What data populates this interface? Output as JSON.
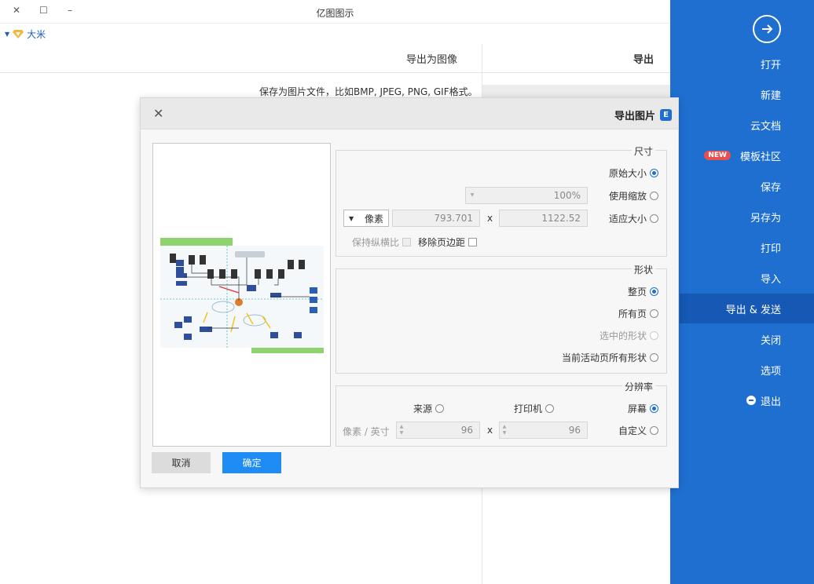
{
  "window": {
    "title": "亿图图示",
    "user": "大米"
  },
  "sidebar": {
    "items": [
      {
        "label": "打开"
      },
      {
        "label": "新建"
      },
      {
        "label": "云文档"
      },
      {
        "label": "模板社区",
        "badge": "NEW"
      },
      {
        "label": "保存"
      },
      {
        "label": "另存为"
      },
      {
        "label": "打印"
      },
      {
        "label": "导入"
      },
      {
        "label": "导出 & 发送"
      },
      {
        "label": "关闭"
      },
      {
        "label": "选项"
      },
      {
        "label": "退出"
      }
    ]
  },
  "panel": {
    "export_title": "导出",
    "export_image_title": "导出为图像",
    "description": "保存为图片文件，比如BMP, JPEG, PNG, GIF格式。"
  },
  "dialog": {
    "title": "导出图片",
    "size": {
      "legend": "尺寸",
      "original": "原始大小",
      "use_scale": "使用缩放",
      "scale_value": "100%",
      "fit_size": "适应大小",
      "width": "1122.52",
      "height": "793.701",
      "times": "x",
      "unit": "像素",
      "remove_margin": "移除页边距",
      "keep_ratio": "保持纵横比"
    },
    "shape": {
      "legend": "形状",
      "whole_page": "整页",
      "all_pages": "所有页",
      "selected_shapes": "选中的形状",
      "current_page_shapes": "当前活动页所有形状"
    },
    "resolution": {
      "legend": "分辨率",
      "screen": "屏幕",
      "printer": "打印机",
      "source": "来源",
      "custom": "自定义",
      "x_value": "96",
      "y_value": "96",
      "times": "x",
      "unit": "像素 / 英寸"
    },
    "buttons": {
      "ok": "确定",
      "cancel": "取消"
    }
  },
  "colors": {
    "sidebar": "#1f6fd1",
    "sidebar_active": "#1559b5",
    "primary_button": "#1f8cf5",
    "new_badge": "#e8504f"
  }
}
